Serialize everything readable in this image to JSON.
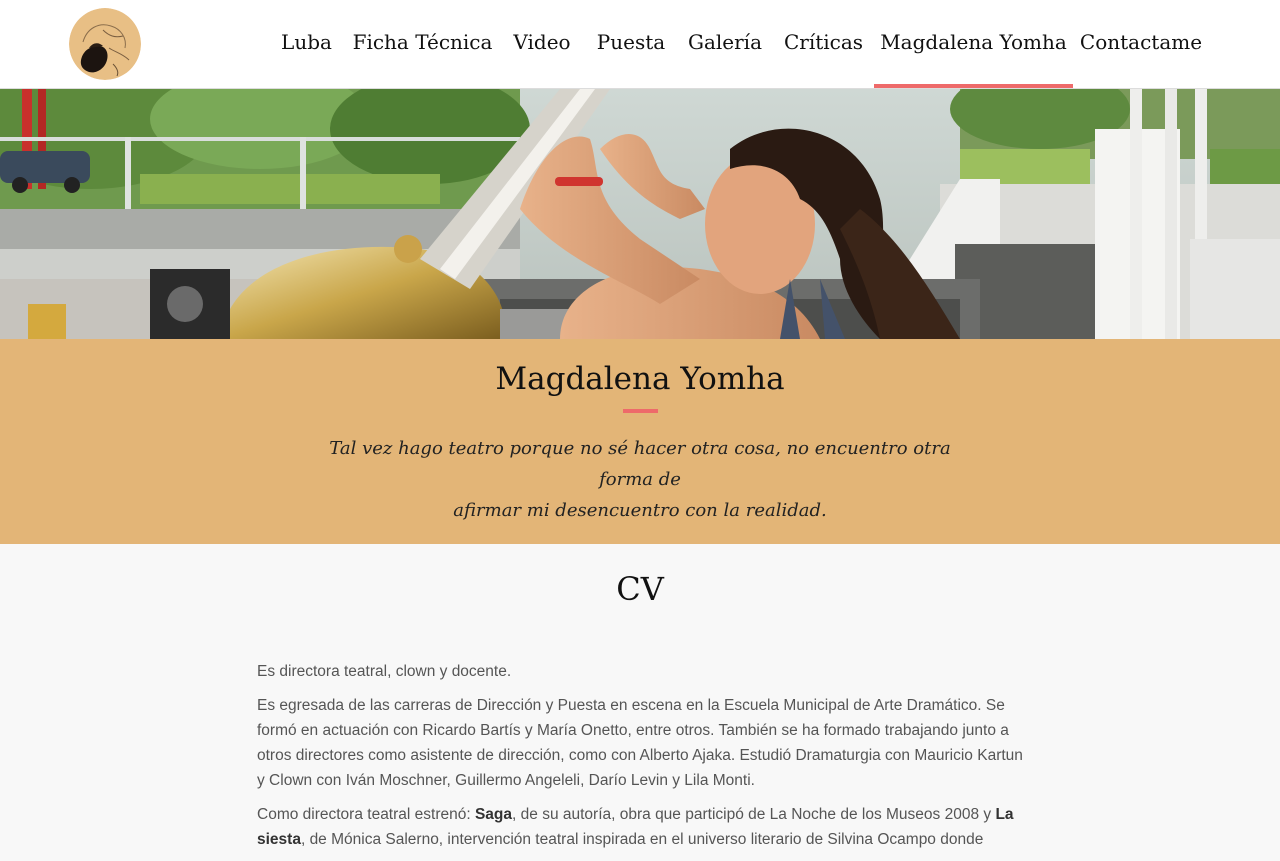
{
  "colors": {
    "accent": "#ee6a6a",
    "band": "#e3b577",
    "header_bg": "#ffffff",
    "page_bg": "#f8f8f8"
  },
  "header": {
    "logo_icon": "logo-sketch-icon",
    "nav": [
      {
        "label": "Luba",
        "active": false
      },
      {
        "label": "Ficha Técnica",
        "active": false
      },
      {
        "label": "Video",
        "active": false
      },
      {
        "label": "Puesta",
        "active": false
      },
      {
        "label": "Galería",
        "active": false
      },
      {
        "label": "Críticas",
        "active": false
      },
      {
        "label": "Magdalena Yomha",
        "active": true
      },
      {
        "label": "Contactame",
        "active": false
      }
    ]
  },
  "band": {
    "title": "Magdalena Yomha",
    "quote_line1": "Tal vez hago teatro porque no sé hacer otra cosa, no encuentro otra forma de",
    "quote_line2": "afirmar mi desencuentro con la realidad."
  },
  "cv": {
    "title": "CV",
    "p1": "Es directora teatral, clown y docente.",
    "p2": "Es egresada de las carreras de Dirección y Puesta en escena en la Escuela Municipal de Arte Dramático. Se formó en actuación con Ricardo Bartís y María Onetto, entre otros. También se ha formado trabajando junto a otros directores como asistente de dirección, como con Alberto Ajaka. Estudió Dramaturgia con Mauricio Kartun y Clown con Iván Moschner, Guillermo Angeleli, Darío Levin y Lila Monti.",
    "p3_a": "Como directora teatral estrenó: ",
    "p3_b": "Saga",
    "p3_c": ", de su autoría, obra que participó de La Noche de los Museos 2008 y ",
    "p3_d": "La siesta",
    "p3_e": ", de Mónica Salerno, intervención teatral inspirada en el universo literario de Silvina Ocampo donde"
  }
}
